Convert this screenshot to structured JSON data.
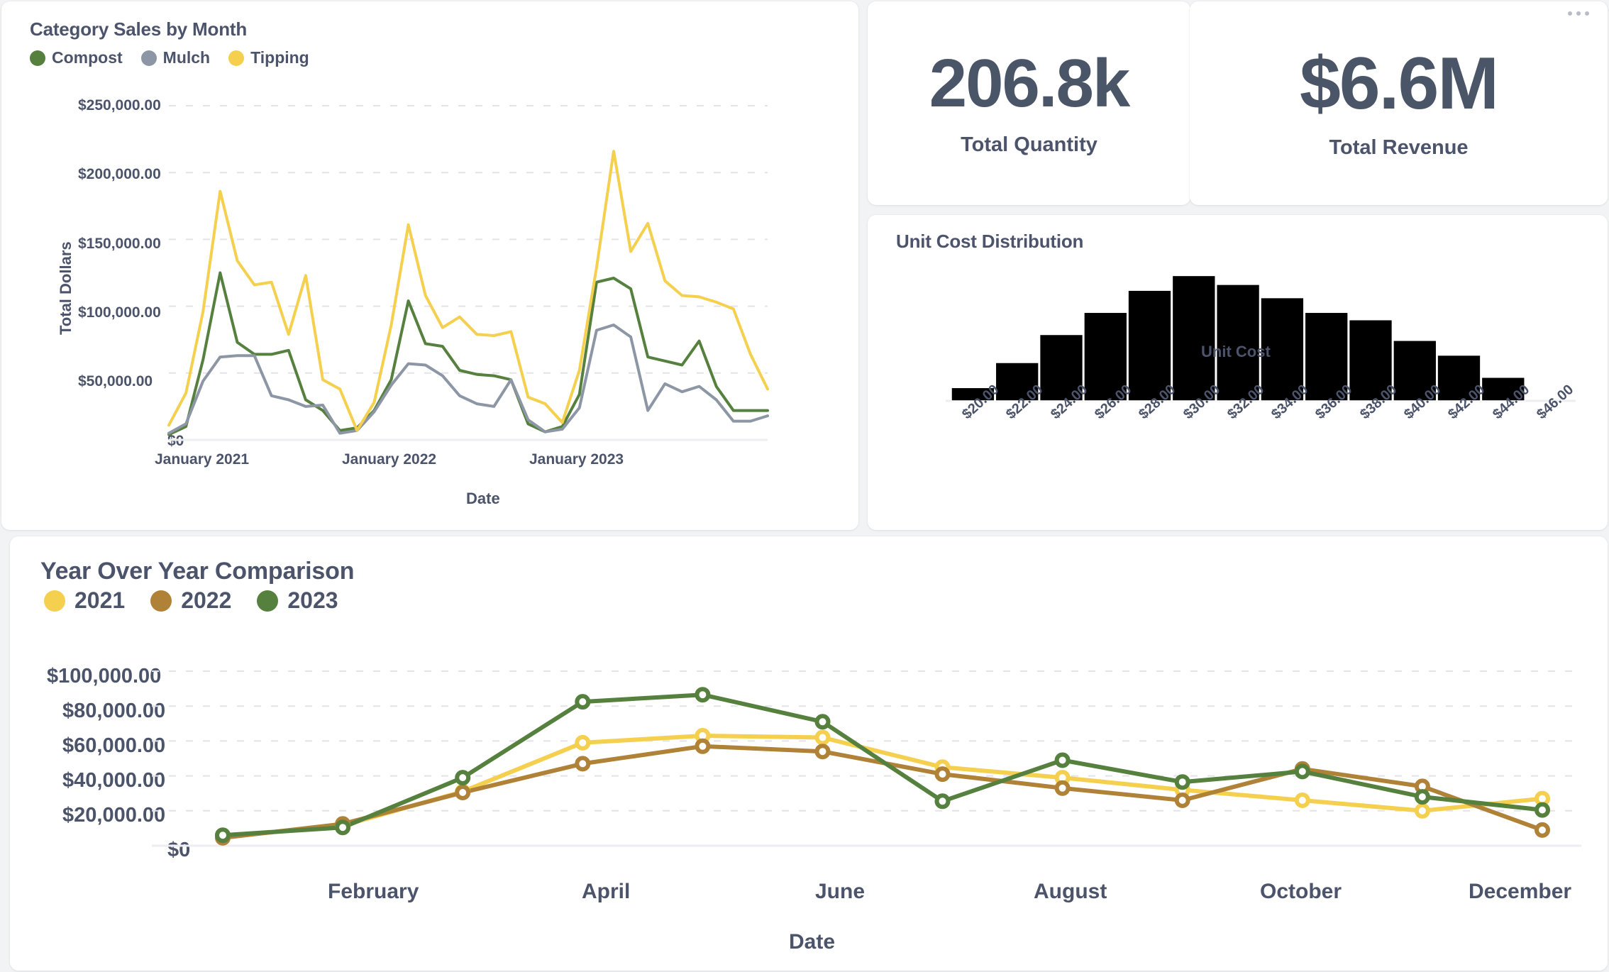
{
  "theme": {
    "page_background": "#f2f3f5",
    "card_background": "#ffffff",
    "text_color": "#4c546b",
    "kpi_color": "#4a5568",
    "grid_color": "#e3e4e8"
  },
  "cards": {
    "category_sales": {
      "title": "Category Sales by Month"
    },
    "unit_cost": {
      "title": "Unit Cost Distribution"
    },
    "yoy": {
      "title": "Year Over Year Comparison"
    }
  },
  "kpis": [
    {
      "value": "206.8k",
      "label": "Total Quantity"
    },
    {
      "value": "$6.6M",
      "label": "Total Revenue"
    }
  ],
  "menu": {
    "icon": "ellipsis-icon"
  },
  "chart_data": [
    {
      "id": "category-sales-by-month",
      "type": "line",
      "title": "Category Sales by Month",
      "xlabel": "Date",
      "ylabel": "Total Dollars",
      "ylim": [
        0,
        250000
      ],
      "yticks": [
        0,
        50000,
        100000,
        150000,
        200000,
        250000
      ],
      "ytick_labels": [
        "$0",
        "$50,000.00",
        "$100,000.00",
        "$150,000.00",
        "$200,000.00",
        "$250,000.00"
      ],
      "xtick_labels": [
        "January 2021",
        "January 2022",
        "January 2023"
      ],
      "xtick_indices": [
        0,
        12,
        24
      ],
      "grid": true,
      "legend_position": "top-left",
      "x": [
        "2021-01",
        "2021-02",
        "2021-03",
        "2021-04",
        "2021-05",
        "2021-06",
        "2021-07",
        "2021-08",
        "2021-09",
        "2021-10",
        "2021-11",
        "2021-12",
        "2022-01",
        "2022-02",
        "2022-03",
        "2022-04",
        "2022-05",
        "2022-06",
        "2022-07",
        "2022-08",
        "2022-09",
        "2022-10",
        "2022-11",
        "2022-12",
        "2023-01",
        "2023-02",
        "2023-03",
        "2023-04",
        "2023-05",
        "2023-06",
        "2023-07",
        "2023-08",
        "2023-09",
        "2023-10",
        "2023-11",
        "2023-12"
      ],
      "series": [
        {
          "name": "Compost",
          "color": "#55803e",
          "values": [
            4000,
            10000,
            60000,
            125000,
            73000,
            64000,
            64000,
            67000,
            30000,
            22000,
            7000,
            9000,
            22000,
            45000,
            104000,
            72000,
            70000,
            52000,
            49000,
            48000,
            45000,
            12000,
            6000,
            10000,
            34000,
            118000,
            121000,
            113000,
            62000,
            59000,
            56000,
            74000,
            40000,
            22000,
            22000,
            22000
          ]
        },
        {
          "name": "Mulch",
          "color": "#8d96a5",
          "values": [
            5000,
            12000,
            44000,
            62000,
            63000,
            63000,
            33000,
            30000,
            25000,
            26000,
            5000,
            7000,
            21000,
            41000,
            57000,
            56000,
            48000,
            33000,
            27000,
            25000,
            45000,
            15000,
            6000,
            8000,
            24000,
            82000,
            86000,
            77000,
            22000,
            42000,
            36000,
            40000,
            30000,
            14000,
            14000,
            18000
          ]
        },
        {
          "name": "Tipping",
          "color": "#f5d04e",
          "values": [
            11000,
            35000,
            96000,
            186000,
            134000,
            116000,
            118000,
            79000,
            123000,
            45000,
            38000,
            7000,
            28000,
            86000,
            161000,
            108000,
            84000,
            92000,
            79000,
            78000,
            81000,
            32000,
            27000,
            13000,
            52000,
            129000,
            216000,
            141000,
            162000,
            119000,
            108000,
            107000,
            103000,
            98000,
            64000,
            38000
          ]
        }
      ]
    },
    {
      "id": "unit-cost-distribution",
      "type": "bar",
      "title": "Unit Cost Distribution",
      "xlabel": "Unit Cost",
      "ylabel": "",
      "bar_color": "#000000",
      "grid": false,
      "categories": [
        "$20.00",
        "$22.00",
        "$24.00",
        "$26.00",
        "$28.00",
        "$30.00",
        "$32.00",
        "$34.00",
        "$36.00",
        "$38.00",
        "$40.00",
        "$42.00",
        "$44.00",
        "$46.00"
      ],
      "values": [
        9,
        26,
        45,
        60,
        75,
        85,
        79,
        70,
        60,
        55,
        41,
        31,
        16,
        0
      ],
      "ylim": [
        0,
        90
      ]
    },
    {
      "id": "year-over-year-comparison",
      "type": "line",
      "title": "Year Over Year Comparison",
      "xlabel": "Date",
      "ylabel": "",
      "ylim": [
        0,
        100000
      ],
      "yticks": [
        0,
        20000,
        40000,
        60000,
        80000,
        100000
      ],
      "ytick_labels": [
        "$0",
        "$20,000.00",
        "$40,000.00",
        "$60,000.00",
        "$80,000.00",
        "$100,000.00"
      ],
      "categories": [
        "January",
        "February",
        "March",
        "April",
        "May",
        "June",
        "July",
        "August",
        "September",
        "October",
        "November",
        "December"
      ],
      "xtick_labels": [
        "February",
        "April",
        "June",
        "August",
        "October",
        "December"
      ],
      "xtick_indices": [
        1,
        3,
        5,
        7,
        9,
        11
      ],
      "grid": true,
      "legend_position": "top-left",
      "markers": true,
      "series": [
        {
          "name": "2021",
          "color": "#f5d04e",
          "values": [
            5000,
            11500,
            31000,
            59000,
            63000,
            62000,
            45000,
            39000,
            32000,
            26000,
            20000,
            27000
          ]
        },
        {
          "name": "2022",
          "color": "#b08238",
          "values": [
            4500,
            12500,
            30500,
            47000,
            57000,
            54000,
            41000,
            33000,
            26000,
            44000,
            34000,
            9000
          ]
        },
        {
          "name": "2023",
          "color": "#55803e",
          "values": [
            6000,
            10500,
            39000,
            82500,
            86500,
            71000,
            25500,
            49000,
            36500,
            42500,
            28000,
            20500
          ]
        }
      ]
    }
  ]
}
